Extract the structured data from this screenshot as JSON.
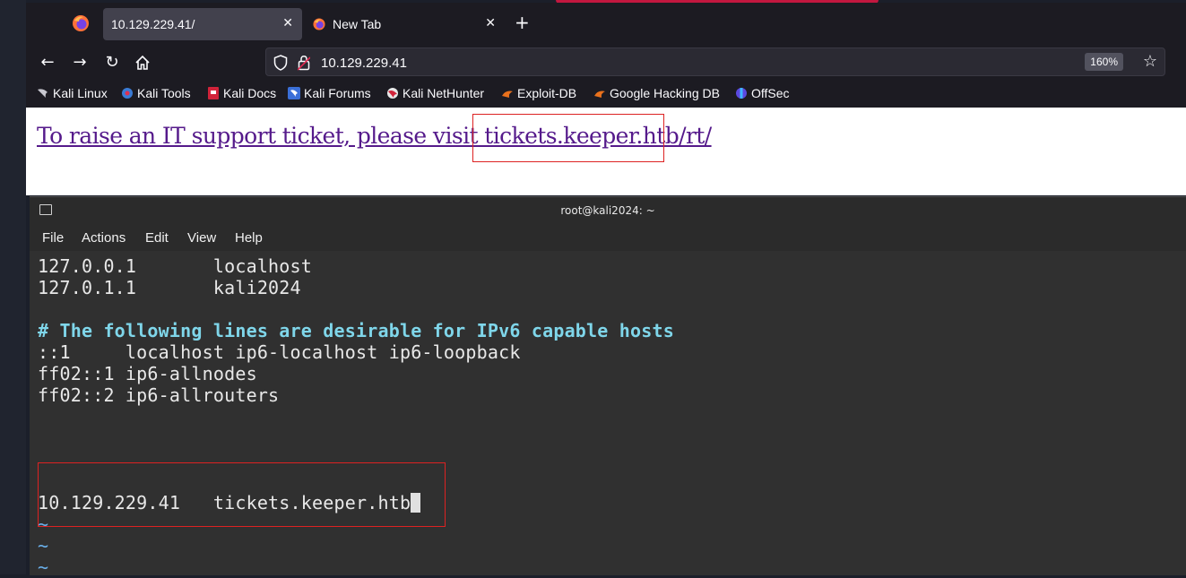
{
  "browser": {
    "tabs": [
      {
        "label": "10.129.229.41/",
        "active": true
      },
      {
        "label": "New Tab",
        "active": false
      }
    ],
    "url": "10.129.229.41",
    "zoom": "160%",
    "bookmarks": [
      {
        "label": "Kali Linux",
        "icon": "kali-icon"
      },
      {
        "label": "Kali Tools",
        "icon": "kali-tools-icon"
      },
      {
        "label": "Kali Docs",
        "icon": "kali-docs-icon"
      },
      {
        "label": "Kali Forums",
        "icon": "kali-forums-icon"
      },
      {
        "label": "Kali NetHunter",
        "icon": "nethunter-icon"
      },
      {
        "label": "Exploit-DB",
        "icon": "exploitdb-icon"
      },
      {
        "label": "Google Hacking DB",
        "icon": "ghdb-icon"
      },
      {
        "label": "OffSec",
        "icon": "offsec-icon"
      }
    ],
    "page": {
      "link_text": "To raise an IT support ticket, please visit tickets.keeper.htb/rt/"
    }
  },
  "terminal": {
    "title": "root@kali2024: ~",
    "menu": [
      "File",
      "Actions",
      "Edit",
      "View",
      "Help"
    ],
    "lines": {
      "l1": "127.0.0.1       localhost",
      "l2": "127.0.1.1       kali2024",
      "l3": "# The following lines are desirable for IPv6 capable hosts",
      "l4": "::1     localhost ip6-localhost ip6-loopback",
      "l5": "ff02::1 ip6-allnodes",
      "l6": "ff02::2 ip6-allrouters",
      "l7": "10.129.229.41   tickets.keeper.htb",
      "tilde": "~"
    }
  },
  "colors": {
    "link": "#551a8b",
    "highlight_box": "#dd2222",
    "comment": "#7fd6ea",
    "tilde": "#6ab0ea"
  }
}
